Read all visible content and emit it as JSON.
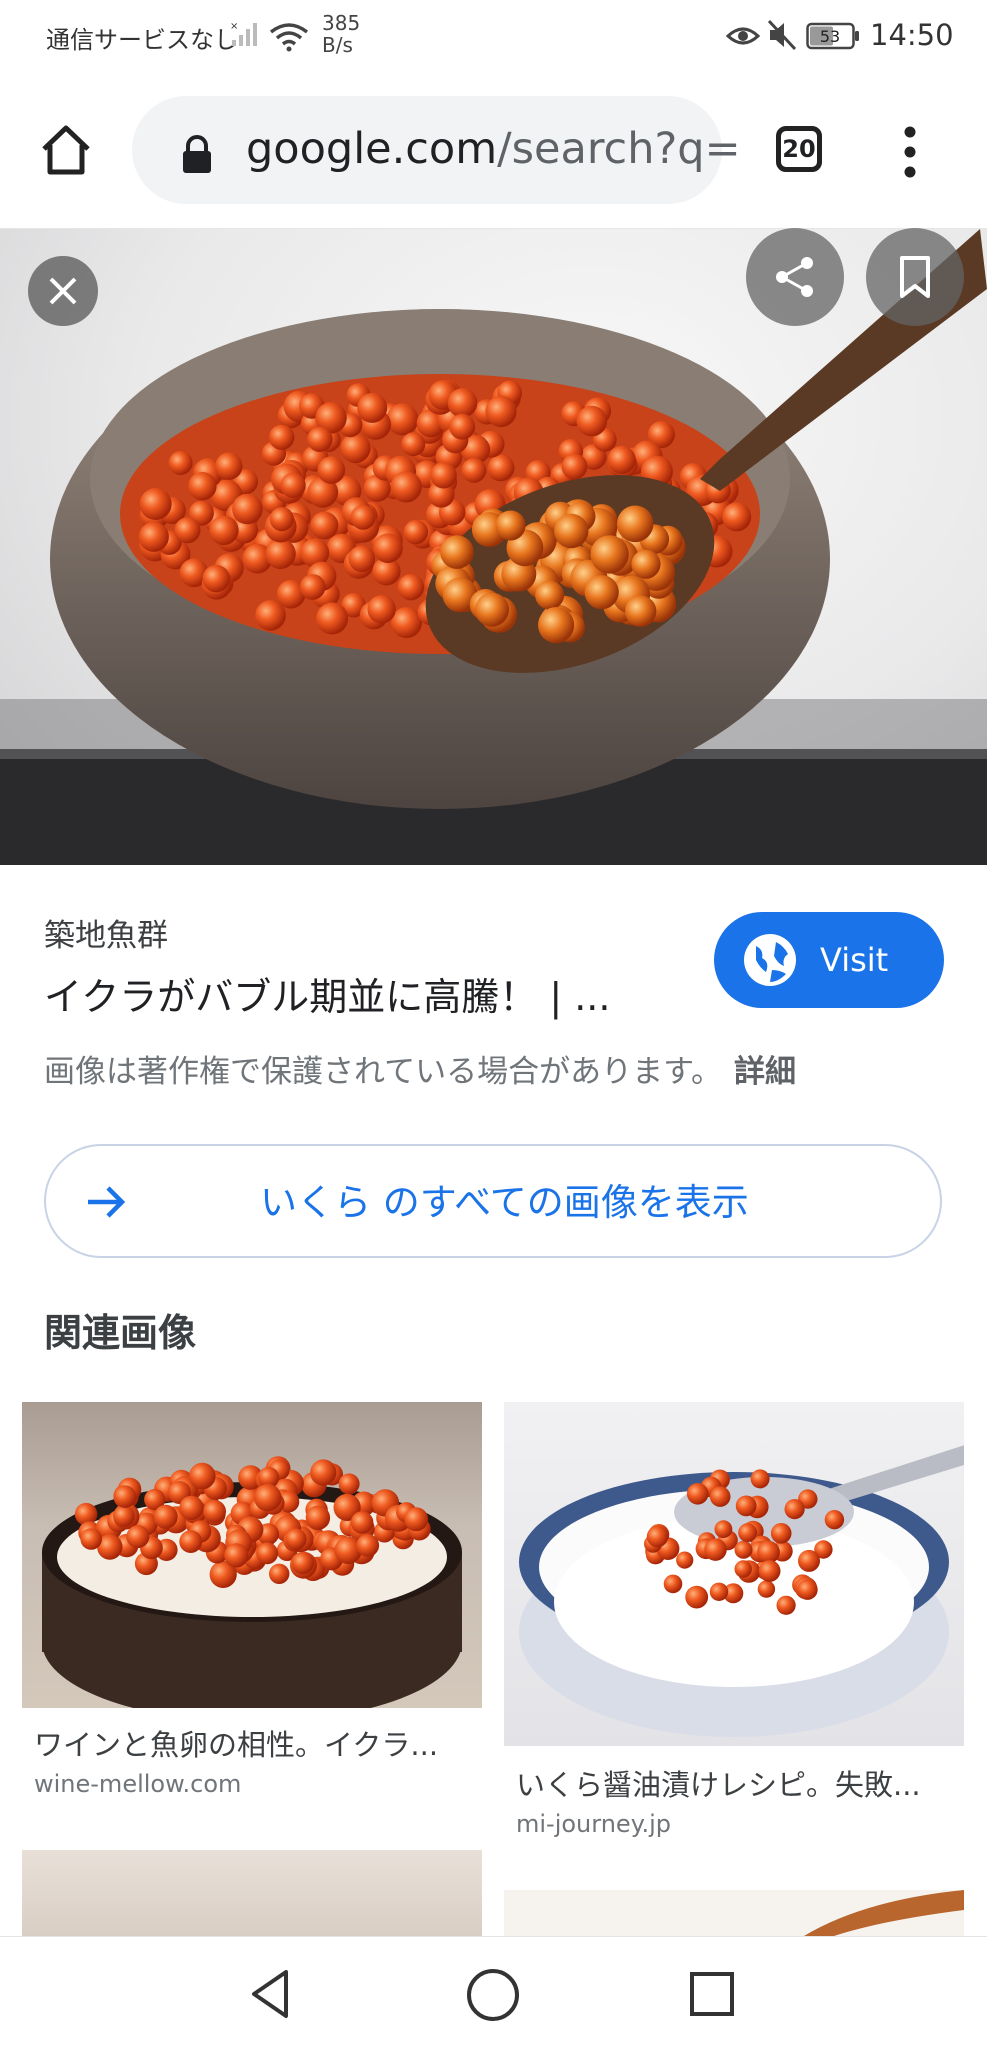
{
  "status_bar": {
    "carrier": "通信サービスなし",
    "net_speed_value": "385",
    "net_speed_unit": "B/s",
    "battery": "53",
    "time": "14:50"
  },
  "browser": {
    "url_host": "google.com",
    "url_path": "/search?q=",
    "tab_count": "20"
  },
  "result": {
    "source": "築地魚群",
    "title": "イクラがバブル期並に高騰！ | ...",
    "visit_label": "Visit",
    "copyright": "画像は著作権で保護されている場合があります。",
    "details": "詳細",
    "all_images": "いくら のすべての画像を表示"
  },
  "related": {
    "heading": "関連画像",
    "items": [
      {
        "caption": "ワインと魚卵の相性。イクラ...",
        "domain": "wine-mellow.com"
      },
      {
        "caption": "いくら醤油漬けレシピ。失敗...",
        "domain": "mi-journey.jp"
      }
    ]
  },
  "colors": {
    "accent": "#1a73e8",
    "roe": "#e8481c"
  }
}
